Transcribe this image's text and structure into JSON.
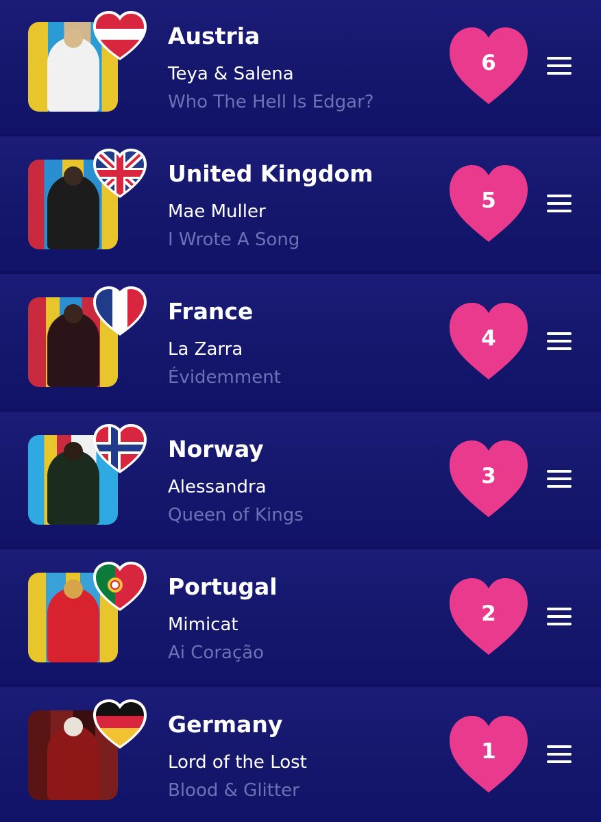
{
  "entries": [
    {
      "country": "Austria",
      "artist": "Teya & Salena",
      "song": "Who The Hell Is Edgar?",
      "points": "6",
      "flag_icon": "austria-flag-heart-icon",
      "photo": {
        "drape": "#e8c52a",
        "outfit": "#f1f1f1",
        "hair": "#d8b98c"
      }
    },
    {
      "country": "United Kingdom",
      "artist": "Mae Muller",
      "song": "I Wrote A Song",
      "points": "5",
      "flag_icon": "uk-flag-heart-icon",
      "photo": {
        "drape": "#2a8fd0",
        "outfit": "#1c1c1c",
        "hair": "#3a2a22"
      }
    },
    {
      "country": "France",
      "artist": "La Zarra",
      "song": "Évidemment",
      "points": "4",
      "flag_icon": "france-flag-heart-icon",
      "photo": {
        "drape": "#c92a3d",
        "outfit": "#2b1418",
        "hair": "#3a261c"
      }
    },
    {
      "country": "Norway",
      "artist": "Alessandra",
      "song": "Queen of Kings",
      "points": "3",
      "flag_icon": "norway-flag-heart-icon",
      "photo": {
        "drape": "#2fa9e2",
        "outfit": "#1b2c1e",
        "hair": "#2c1f18"
      }
    },
    {
      "country": "Portugal",
      "artist": "Mimicat",
      "song": "Ai Coração",
      "points": "2",
      "flag_icon": "portugal-flag-heart-icon",
      "photo": {
        "drape": "#3aa0d8",
        "outfit": "#d8222e",
        "hair": "#d7a44c"
      }
    },
    {
      "country": "Germany",
      "artist": "Lord of the Lost",
      "song": "Blood & Glitter",
      "points": "1",
      "flag_icon": "germany-flag-heart-icon",
      "photo": {
        "drape": "#7a1e1e",
        "outfit": "#8e1717",
        "hair": "#e8e2d8"
      }
    }
  ],
  "colors": {
    "heart": "#ea3a8d",
    "song_text": "#6c72b4",
    "background": "#0f1160"
  },
  "drag_icon": "drag-handle-icon"
}
